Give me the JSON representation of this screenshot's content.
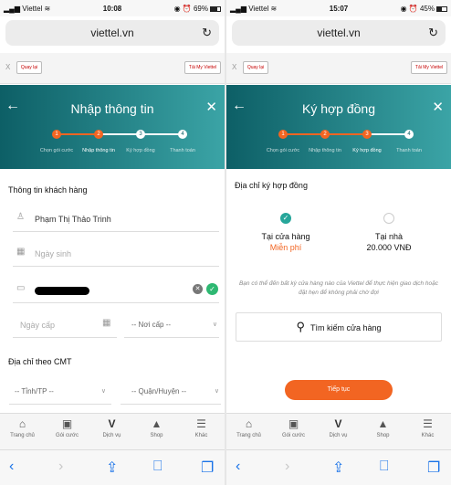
{
  "left": {
    "status": {
      "carrier": "Viettel",
      "time": "10:08",
      "battery": "69%",
      "battery_level": 0.69
    },
    "url": "viettel.vn",
    "banner": {
      "close": "X",
      "back": "Quay lại",
      "my": "Tải My Viettel"
    },
    "header_title": "Nhập thông tin",
    "steps": [
      {
        "num": "1",
        "label": "Chọn gói cước",
        "state": "done"
      },
      {
        "num": "2",
        "label": "Nhập thông tin",
        "state": "active"
      },
      {
        "num": "3",
        "label": "Ký hợp đồng",
        "state": "todo"
      },
      {
        "num": "4",
        "label": "Thanh toán",
        "state": "todo"
      }
    ],
    "customer_section": "Thông tin khách hàng",
    "name_value": "Phạm Thị Thảo Trinh",
    "dob_placeholder": "Ngày sinh",
    "issue_date_placeholder": "Ngày cấp",
    "issue_place": "-- Nơi cấp --",
    "address_section": "Địa chỉ theo CMT",
    "province": "-- Tỉnh/TP --",
    "district": "-- Quận/Huyện --"
  },
  "right": {
    "status": {
      "carrier": "Viettel",
      "time": "15:07",
      "battery": "45%",
      "battery_level": 0.45
    },
    "url": "viettel.vn",
    "banner": {
      "close": "X",
      "back": "Quay lại",
      "my": "Tải My Viettel"
    },
    "header_title": "Ký hợp đồng",
    "steps": [
      {
        "num": "1",
        "label": "Chọn gói cước",
        "state": "done"
      },
      {
        "num": "2",
        "label": "Nhập thông tin",
        "state": "done"
      },
      {
        "num": "3",
        "label": "Ký hợp đồng",
        "state": "active"
      },
      {
        "num": "4",
        "label": "Thanh toán",
        "state": "todo"
      }
    ],
    "section": "Địa chỉ ký hợp đồng",
    "opt_store": {
      "title": "Tại cửa hàng",
      "price": "Miễn phí",
      "selected": true
    },
    "opt_home": {
      "title": "Tại nhà",
      "price": "20.000 VNĐ",
      "selected": false
    },
    "note": "Bạn có thể đến bất kỳ cửa hàng nào của Viettel để thực hiện giao dịch hoặc đặt hẹn để không phải chờ đợi",
    "search_label": "Tìm kiếm cửa hàng",
    "continue_label": "Tiếp tục"
  },
  "nav": [
    "Trang chủ",
    "Gói cước",
    "Dịch vụ",
    "Shop",
    "Khác"
  ],
  "nav_icons": [
    "home-icon",
    "package-icon",
    "services-icon",
    "shop-icon",
    "menu-icon"
  ],
  "colors": {
    "accent": "#f26522",
    "teal_dark": "#0d5f66",
    "teal_light": "#3ba4a6",
    "ok_green": "#26a69a",
    "link_blue": "#1a73e8"
  }
}
